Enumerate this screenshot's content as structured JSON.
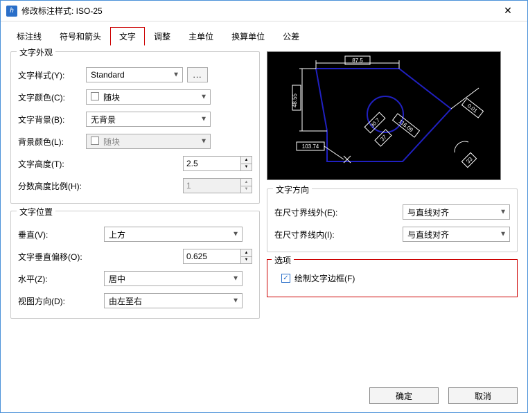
{
  "window": {
    "title": "修改标注样式: ISO-25"
  },
  "tabs": {
    "items": [
      "标注线",
      "符号和箭头",
      "文字",
      "调整",
      "主单位",
      "换算单位",
      "公差"
    ],
    "active_index": 2
  },
  "appearance": {
    "title": "文字外观",
    "style_label": "文字样式(Y):",
    "style_value": "Standard",
    "dots": "...",
    "color_label": "文字颜色(C):",
    "color_value": "随块",
    "bg_label": "文字背景(B):",
    "bg_value": "无背景",
    "bgcolor_label": "背景颜色(L):",
    "bgcolor_value": "随块",
    "height_label": "文字高度(T):",
    "height_value": "2.5",
    "frac_label": "分数高度比例(H):",
    "frac_value": "1"
  },
  "position": {
    "title": "文字位置",
    "vert_label": "垂直(V):",
    "vert_value": "上方",
    "offset_label": "文字垂直偏移(O):",
    "offset_value": "0.625",
    "horiz_label": "水平(Z):",
    "horiz_value": "居中",
    "viewdir_label": "视图方向(D):",
    "viewdir_value": "由左至右"
  },
  "direction": {
    "title": "文字方向",
    "out_label": "在尺寸界线外(E):",
    "out_value": "与直线对齐",
    "in_label": "在尺寸界线内(I):",
    "in_value": "与直线对齐"
  },
  "options": {
    "title": "选项",
    "drawframe_label": "绘制文字边框(F)",
    "drawframe_checked": true
  },
  "preview": {
    "dims": {
      "top": "87.5",
      "left": "48.55",
      "angle1": "30.7",
      "angle2": "37",
      "diag": "116.09",
      "right": "0.01",
      "radius": "33",
      "bottom": "103.74"
    }
  },
  "footer": {
    "ok": "确定",
    "cancel": "取消"
  }
}
